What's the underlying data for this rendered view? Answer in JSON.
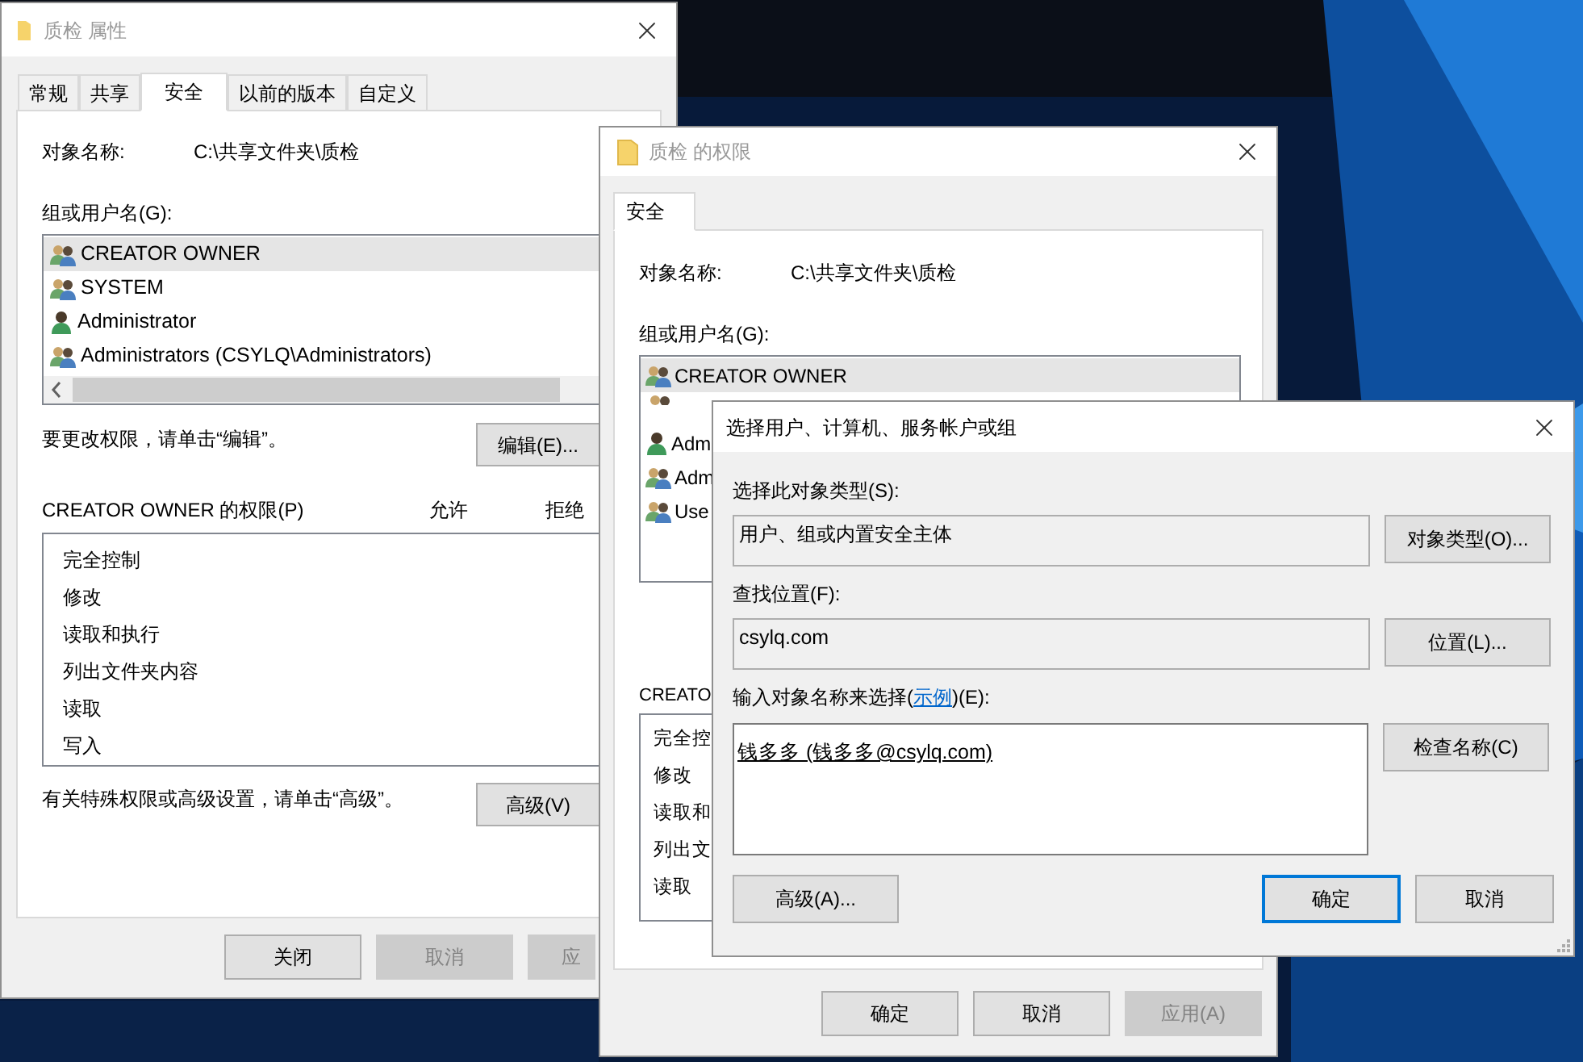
{
  "properties_window": {
    "title": "质检 属性",
    "tabs": [
      {
        "label": "常规",
        "selected": false
      },
      {
        "label": "共享",
        "selected": false
      },
      {
        "label": "安全",
        "selected": true
      },
      {
        "label": "以前的版本",
        "selected": false
      },
      {
        "label": "自定义",
        "selected": false
      }
    ],
    "object_label": "对象名称:",
    "object_path": "C:\\共享文件夹\\质检",
    "groups_label": "组或用户名(G):",
    "users": [
      {
        "name": "CREATOR OWNER",
        "kind": "group",
        "selected": true
      },
      {
        "name": "SYSTEM",
        "kind": "group",
        "selected": false
      },
      {
        "name": "Administrator",
        "kind": "user",
        "selected": false
      },
      {
        "name": "Administrators (CSYLQ\\Administrators)",
        "kind": "group",
        "selected": false
      }
    ],
    "edit_hint": "要更改权限，请单击“编辑”。",
    "edit_button": "编辑(E)...",
    "permissions_label": "CREATOR OWNER 的权限(P)",
    "allow_header": "允许",
    "deny_header": "拒绝",
    "permissions": [
      "完全控制",
      "修改",
      "读取和执行",
      "列出文件夹内容",
      "读取",
      "写入"
    ],
    "advanced_hint": "有关特殊权限或高级设置，请单击“高级”。",
    "advanced_button": "高级(V)",
    "buttons": [
      {
        "label": "关闭",
        "disabled": false
      },
      {
        "label": "取消",
        "disabled": true
      },
      {
        "label": "应",
        "disabled": true
      }
    ]
  },
  "permissions_window": {
    "title": "质检 的权限",
    "tabs": [
      {
        "label": "安全",
        "selected": true
      }
    ],
    "object_label": "对象名称:",
    "object_path": "C:\\共享文件夹\\质检",
    "groups_label": "组或用户名(G):",
    "users": [
      {
        "name": "CREATOR OWNER",
        "kind": "group",
        "selected": true
      },
      {
        "kind": "group",
        "selected": false
      },
      {
        "name": "Adm",
        "kind": "user",
        "selected": false
      },
      {
        "name": "Adm",
        "kind": "group",
        "selected": false
      },
      {
        "name": "Use",
        "kind": "group",
        "selected": false
      }
    ],
    "permissions_label": "CREATO",
    "permissions": [
      "完全控",
      "修改",
      "读取和",
      "列出文",
      "读取"
    ],
    "buttons": [
      {
        "label": "确定",
        "disabled": false
      },
      {
        "label": "取消",
        "disabled": false
      },
      {
        "label": "应用(A)",
        "disabled": true
      }
    ]
  },
  "select_dialog": {
    "title": "选择用户、计算机、服务帐户或组",
    "object_type_label": "选择此对象类型(S):",
    "object_type_value": "用户、组或内置安全主体",
    "object_types_button": "对象类型(O)...",
    "location_label": "查找位置(F):",
    "location_value": "csylq.com",
    "locations_button": "位置(L)...",
    "names_label_before": "输入对象名称来选择(",
    "names_label_link": "示例",
    "names_label_after": ")(E):",
    "names_value": "钱多多 (钱多多@csylq.com)",
    "check_names_button": "检查名称(C)",
    "advanced_button": "高级(A)...",
    "buttons": [
      {
        "label": "确定",
        "focused": true
      },
      {
        "label": "取消",
        "focused": false
      }
    ]
  }
}
